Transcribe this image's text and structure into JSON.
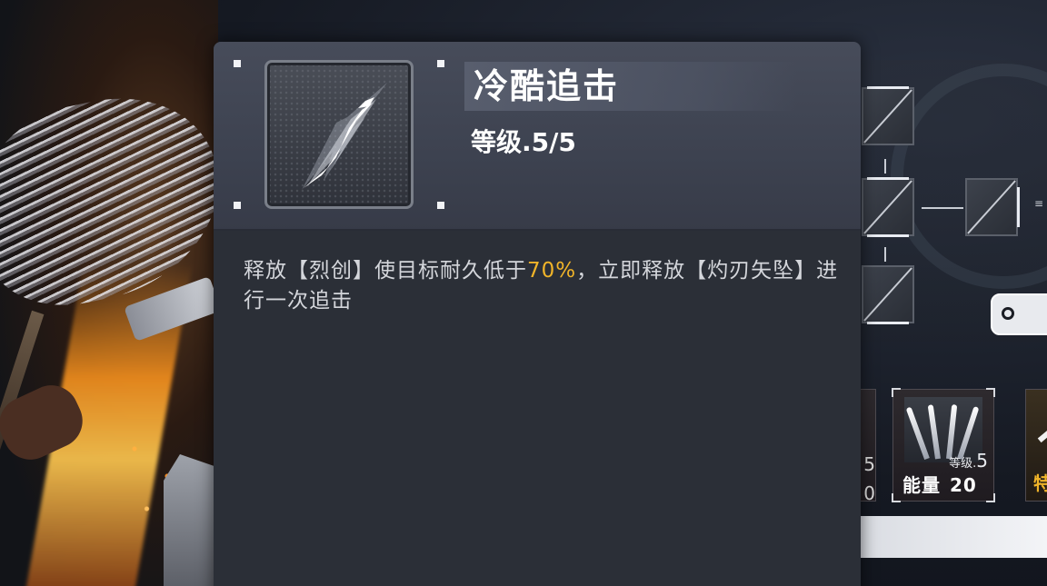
{
  "skill": {
    "title": "冷酷追击",
    "level_text": "等级.5/5",
    "description": {
      "part1": "释放【烈创】使目标耐久低于",
      "highlight": "70%",
      "part2": "，立即释放【灼刃矢坠】进行一次追击"
    },
    "icon": "blade-slash-icon"
  },
  "skill_cards": [
    {
      "level_label": "等级.",
      "level_value": "5",
      "energy_label": "能量",
      "energy_value": "20",
      "icon": "triple-blade-icon"
    }
  ],
  "partial_cards": {
    "left_digits": [
      "5",
      "0"
    ],
    "right_text": "特"
  },
  "colors": {
    "highlight": "#f0b429",
    "panel_bg": "#2b2f37",
    "header_bg": "#474c5a",
    "text_primary": "#ffffff",
    "text_body": "#d4d6db"
  }
}
